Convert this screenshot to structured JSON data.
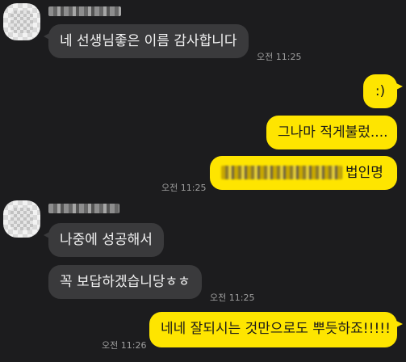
{
  "messages": [
    {
      "side": "in",
      "text": "네 선생님좋은 이름 감사합니다",
      "time": "오전 11:25"
    },
    {
      "side": "out",
      "text": ":)"
    },
    {
      "side": "out",
      "text": "그나마 적게불렀...."
    },
    {
      "side": "out",
      "text": "법인명",
      "redacted": true,
      "time": "오전 11:25"
    },
    {
      "side": "in",
      "text": "나중에 성공해서"
    },
    {
      "side": "in",
      "text": "꼭 보답하겠습니당ㅎㅎ",
      "time": "오전 11:25"
    },
    {
      "side": "out",
      "text": "네네 잘되시는 것만으로도 뿌듯하죠!!!!!",
      "time": "오전 11:26"
    }
  ],
  "colors": {
    "background": "#1c1c1e",
    "incoming": "#3a3a3c",
    "outgoing": "#fee500"
  }
}
